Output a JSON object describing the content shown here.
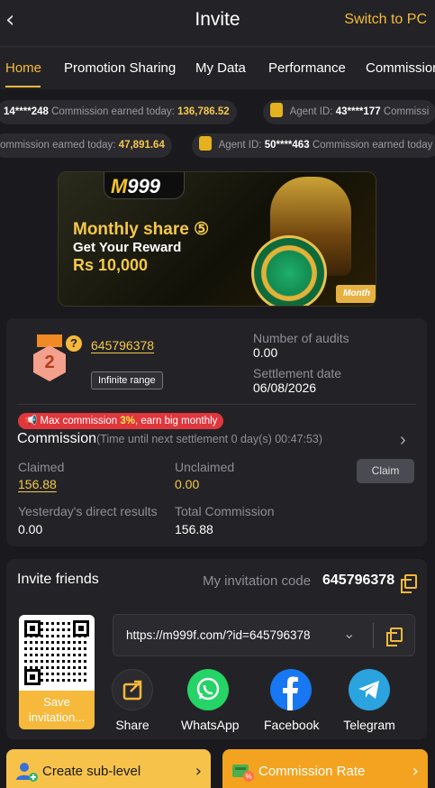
{
  "header": {
    "title": "Invite",
    "switch_label": "Switch to PC"
  },
  "tabs": [
    {
      "label": "Home",
      "active": true
    },
    {
      "label": "Promotion Sharing",
      "active": false
    },
    {
      "label": "My Data",
      "active": false
    },
    {
      "label": "Performance",
      "active": false
    },
    {
      "label": "Commission",
      "active": false
    }
  ],
  "ticker": {
    "row1": [
      {
        "prefix": "",
        "id": "14****248",
        "label": "Commission earned today:",
        "amount": "136,786.52"
      },
      {
        "label": "Agent ID:",
        "id": "43****177",
        "suffix": "Commissi"
      }
    ],
    "row2": [
      {
        "label": "ommission earned today:",
        "amount": "47,891.64"
      },
      {
        "label": "Agent ID:",
        "id": "50****463",
        "suffix": "Commission earned today"
      }
    ]
  },
  "banner": {
    "logo_m": "M",
    "logo_num": "999",
    "line1": "Monthly share ⑤",
    "line2": "Get Your Reward",
    "line3": "Rs 10,000",
    "tag": "Month"
  },
  "account": {
    "level": "2",
    "agent_id": "645796378",
    "range_label": "Infinite range",
    "audits_label": "Number of audits",
    "audits_value": "0.00",
    "settlement_label": "Settlement date",
    "settlement_value": "06/08/2026"
  },
  "commission": {
    "promo_prefix": "Max commission ",
    "promo_highlight": "3%",
    "promo_suffix": ", earn big monthly",
    "title": "Commission",
    "subtitle": "(Time until next settlement  0 day(s) 00:47:53)",
    "claimed_label": "Claimed",
    "claimed_value": "156.88",
    "unclaimed_label": "Unclaimed",
    "unclaimed_value": "0.00",
    "claim_button": "Claim",
    "direct_label": "Yesterday's direct results",
    "direct_value": "0.00",
    "total_label": "Total Commission",
    "total_value": "156.88"
  },
  "invite": {
    "title": "Invite friends",
    "code_label": "My invitation code",
    "code": "645796378",
    "qr_label": "Save invitation...",
    "url": "https://m999f.com/?id=645796378",
    "share": [
      {
        "label": "Share",
        "icon": "share-icon",
        "color": "#2a2a2f"
      },
      {
        "label": "WhatsApp",
        "icon": "whatsapp-icon",
        "color": "#25d366"
      },
      {
        "label": "Facebook",
        "icon": "facebook-icon",
        "color": "#1877f2"
      },
      {
        "label": "Telegram",
        "icon": "telegram-icon",
        "color": "#2aa3de"
      }
    ]
  },
  "actions": {
    "create_sublevel": "Create sub-level",
    "commission_rate": "Commission Rate"
  },
  "colors": {
    "accent": "#f6b93b",
    "background": "#1a1a1e",
    "card": "#232327"
  }
}
